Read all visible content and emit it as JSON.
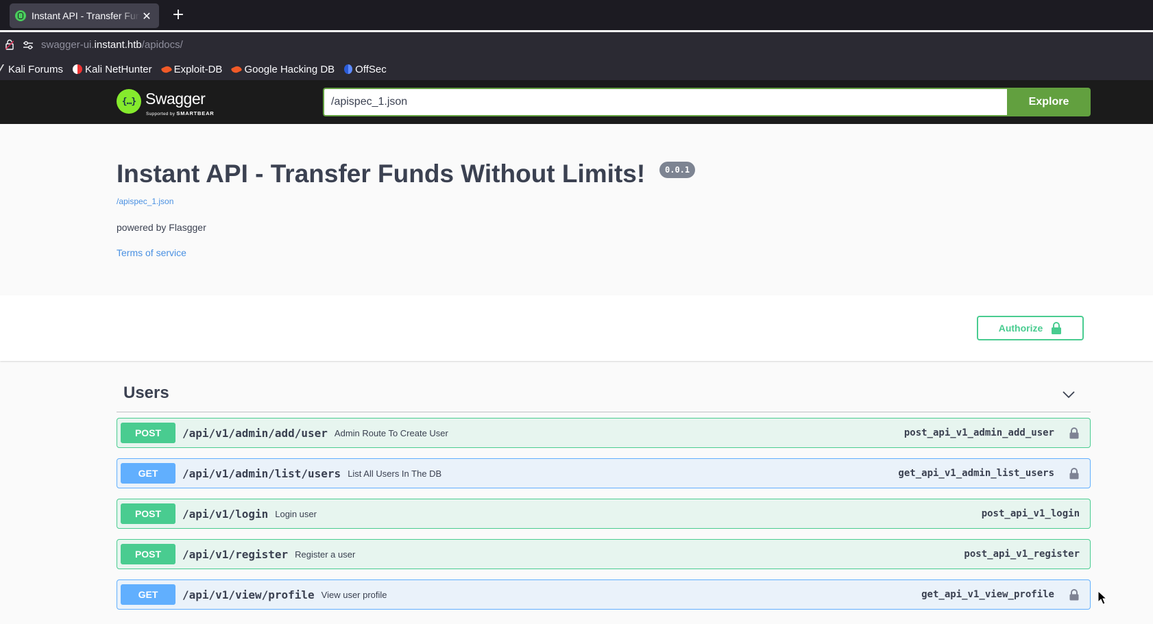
{
  "browser": {
    "tab_title": "Instant API - Transfer Funds Without Limits!",
    "tab_close": "✕",
    "new_tab": "+",
    "url_prefix": "swagger-ui.",
    "url_host": "instant.htb",
    "url_path": "/apidocs/",
    "bookmarks": [
      {
        "label": "Kali Forums",
        "icon": "kali-icon"
      },
      {
        "label": "Kali NetHunter",
        "icon": "nethunter-icon"
      },
      {
        "label": "Exploit-DB",
        "icon": "exploit-db-icon"
      },
      {
        "label": "Google Hacking DB",
        "icon": "ghdb-icon"
      },
      {
        "label": "OffSec",
        "icon": "offsec-icon"
      }
    ]
  },
  "topbar": {
    "logo_glyph": "{…}",
    "brand": "Swagger",
    "supported_by": "Supported by",
    "smartbear": "SMARTBEAR",
    "spec_url": "/apispec_1.json",
    "explore_label": "Explore"
  },
  "info": {
    "title": "Instant API - Transfer Funds Without Limits!",
    "version": "0.0.1",
    "spec_link": "/apispec_1.json",
    "description": "powered by Flasgger",
    "terms": "Terms of service"
  },
  "authorize_label": "Authorize",
  "colors": {
    "post": "#49cc90",
    "get": "#61affe",
    "explore": "#62a03f",
    "link": "#4990e2"
  },
  "tag": {
    "name": "Users",
    "expanded": true
  },
  "operations": [
    {
      "method": "POST",
      "path": "/api/v1/admin/add/user",
      "summary": "Admin Route To Create User",
      "operation_id": "post_api_v1_admin_add_user",
      "locked": true
    },
    {
      "method": "GET",
      "path": "/api/v1/admin/list/users",
      "summary": "List All Users In The DB",
      "operation_id": "get_api_v1_admin_list_users",
      "locked": true
    },
    {
      "method": "POST",
      "path": "/api/v1/login",
      "summary": "Login user",
      "operation_id": "post_api_v1_login",
      "locked": false
    },
    {
      "method": "POST",
      "path": "/api/v1/register",
      "summary": "Register a user",
      "operation_id": "post_api_v1_register",
      "locked": false
    },
    {
      "method": "GET",
      "path": "/api/v1/view/profile",
      "summary": "View user profile",
      "operation_id": "get_api_v1_view_profile",
      "locked": true
    }
  ]
}
